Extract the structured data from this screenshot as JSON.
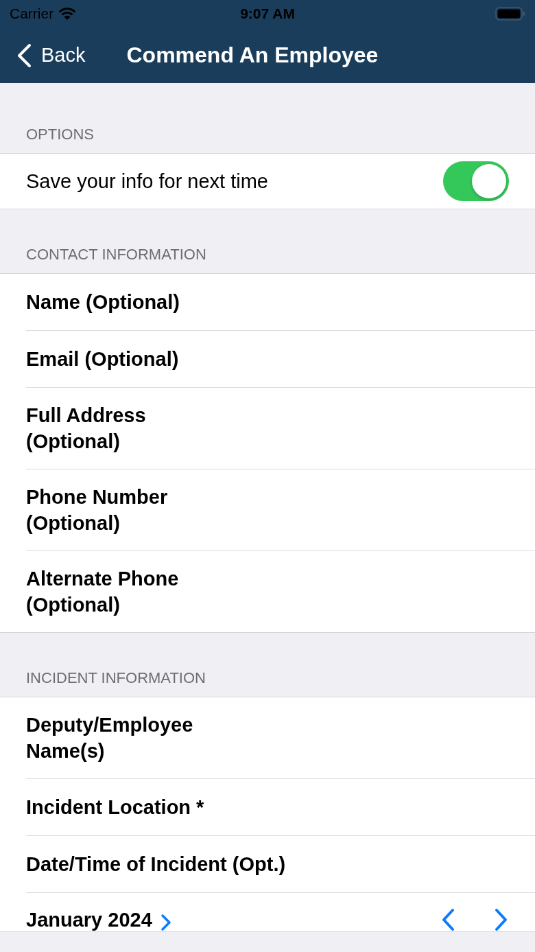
{
  "status_bar": {
    "carrier": "Carrier",
    "time": "9:07 AM"
  },
  "nav_bar": {
    "back": "Back",
    "title": "Commend An Employee"
  },
  "sections": [
    {
      "header": "OPTIONS",
      "rows": [
        {
          "kind": "toggle",
          "label": "Save your info for next time",
          "on": true
        }
      ]
    },
    {
      "header": "CONTACT INFORMATION",
      "rows": [
        {
          "kind": "field",
          "label": "Name (Optional)"
        },
        {
          "kind": "field",
          "label": "Email (Optional)"
        },
        {
          "kind": "field",
          "label": "Full Address\n(Optional)"
        },
        {
          "kind": "field",
          "label": "Phone Number\n(Optional)"
        },
        {
          "kind": "field",
          "label": "Alternate Phone\n(Optional)"
        }
      ]
    },
    {
      "header": "INCIDENT INFORMATION",
      "rows": [
        {
          "kind": "field",
          "label": "Deputy/Employee\nName(s)"
        },
        {
          "kind": "field",
          "label": "Incident Location *"
        },
        {
          "kind": "field",
          "label": "Date/Time of Incident (Opt.)"
        },
        {
          "kind": "calendar",
          "label": "January 2024"
        }
      ]
    }
  ]
}
